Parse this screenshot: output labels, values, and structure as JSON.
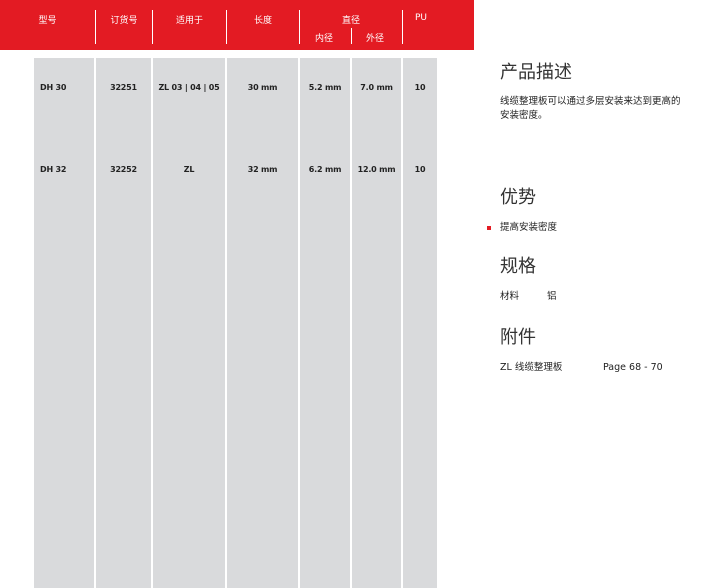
{
  "table": {
    "headers": {
      "model": "型号",
      "order_no": "订货号",
      "for": "适用于",
      "length": "长度",
      "diameter": "直径",
      "inner": "内径",
      "outer": "外径",
      "pu": "PU"
    },
    "rows": [
      {
        "model": "DH 30",
        "order_no": "32251",
        "for": "ZL 03 | 04 | 05",
        "length": "30 mm",
        "inner": "5.2 mm",
        "outer": "7.0 mm",
        "pu": "10"
      },
      {
        "model": "DH 32",
        "order_no": "32252",
        "for": "ZL",
        "length": "32 mm",
        "inner": "6.2 mm",
        "outer": "12.0 mm",
        "pu": "10"
      }
    ]
  },
  "sidebar": {
    "desc_title": "产品描述",
    "desc_text_1": "线缆整理板可以通过多层安装来达到更高的",
    "desc_text_2": "安装密度。",
    "adv_title": "优势",
    "adv_item": "提高安装密度",
    "spec_title": "规格",
    "spec_key": "材料",
    "spec_value": "铝",
    "acc_title": "附件",
    "acc_item": "ZL 线缆整理板",
    "acc_page": "Page 68 - 70"
  },
  "colors": {
    "accent": "#e31b23",
    "column": "#d9dadc"
  }
}
